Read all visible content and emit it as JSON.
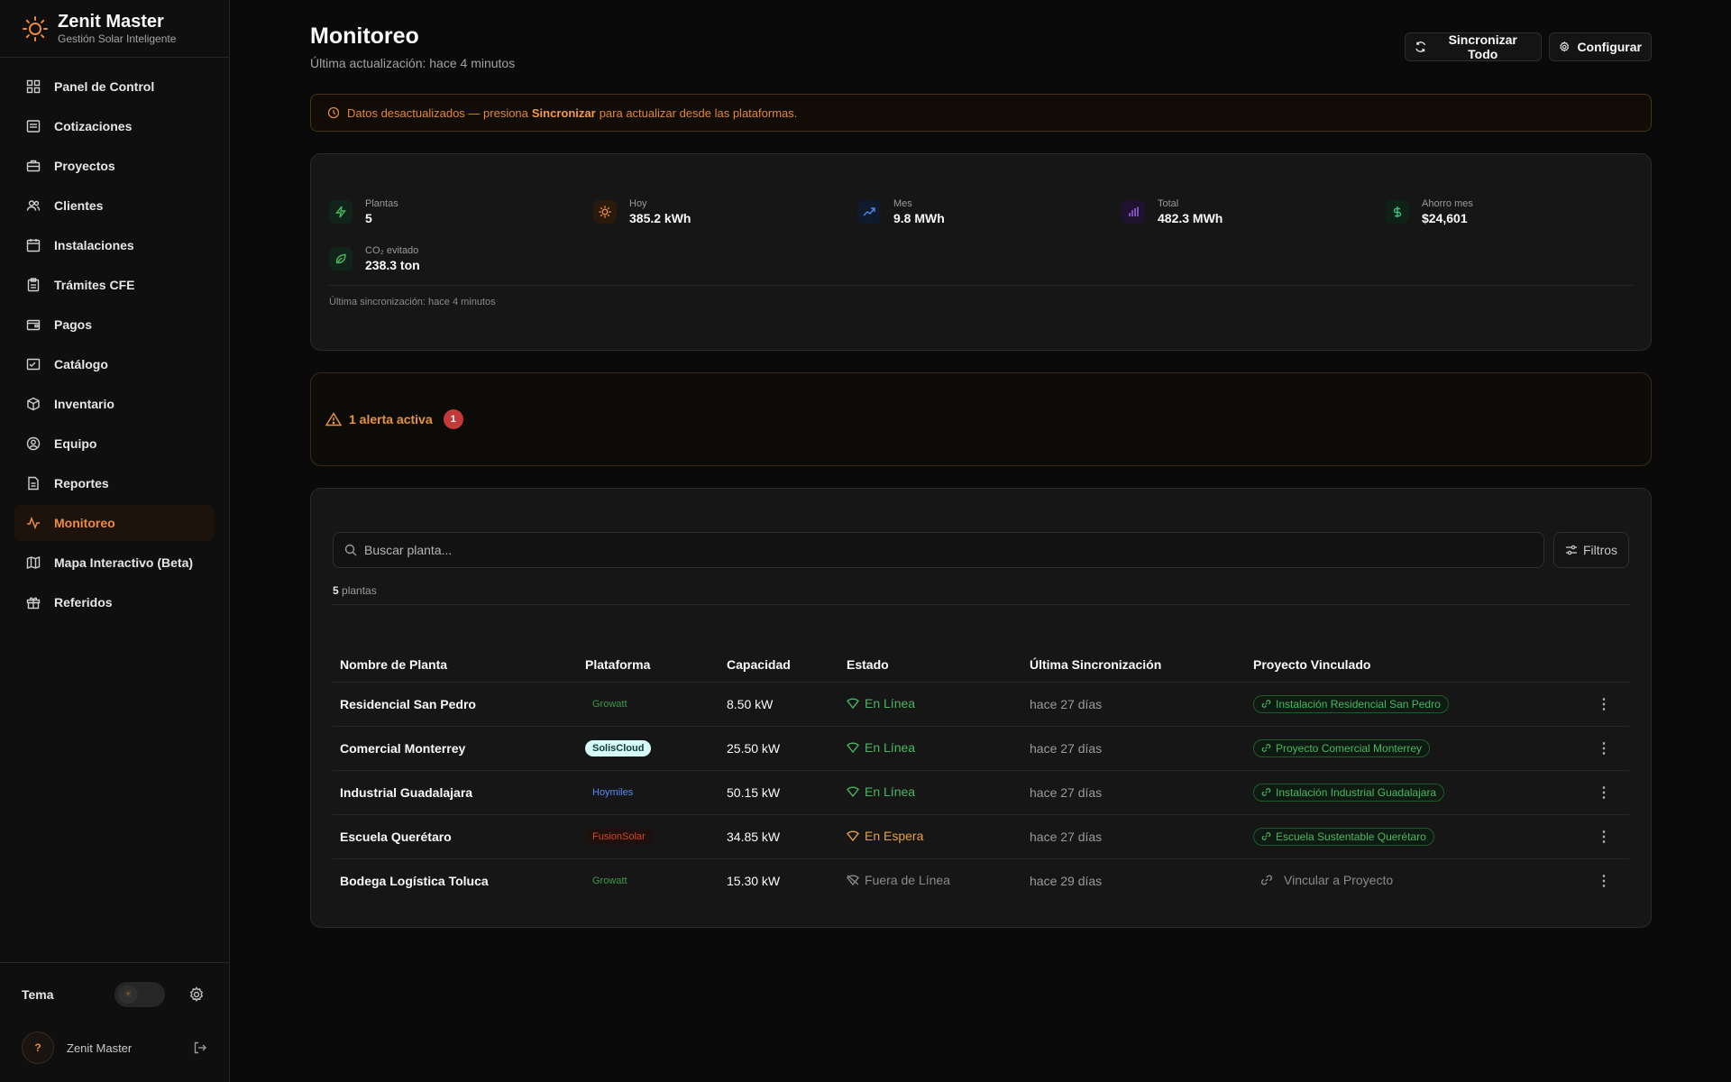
{
  "brand": {
    "title": "Zenit Master",
    "subtitle": "Gestión Solar Inteligente"
  },
  "sidebar": {
    "items": [
      {
        "label": "Panel de Control",
        "icon": "dashboard-icon"
      },
      {
        "label": "Cotizaciones",
        "icon": "quote-icon"
      },
      {
        "label": "Proyectos",
        "icon": "briefcase-icon"
      },
      {
        "label": "Clientes",
        "icon": "users-icon"
      },
      {
        "label": "Instalaciones",
        "icon": "calendar-icon"
      },
      {
        "label": "Trámites CFE",
        "icon": "clipboard-icon"
      },
      {
        "label": "Pagos",
        "icon": "wallet-icon"
      },
      {
        "label": "Catálogo",
        "icon": "catalog-icon"
      },
      {
        "label": "Inventario",
        "icon": "box-icon"
      },
      {
        "label": "Equipo",
        "icon": "user-circle-icon"
      },
      {
        "label": "Reportes",
        "icon": "report-icon"
      },
      {
        "label": "Monitoreo",
        "icon": "activity-icon",
        "active": true
      },
      {
        "label": "Mapa Interactivo (Beta)",
        "icon": "map-icon"
      },
      {
        "label": "Referidos",
        "icon": "gift-icon"
      }
    ],
    "theme_label": "Tema",
    "user_name": "Zenit Master",
    "avatar_text": "?"
  },
  "header": {
    "title": "Monitoreo",
    "subtitle": "Última actualización: hace 4 minutos",
    "sync_all": "Sincronizar Todo",
    "configure": "Configurar"
  },
  "warning": {
    "prefix": "Datos desactualizados — presiona",
    "bold": "Sincronizar",
    "suffix": "para actualizar desde las plataformas."
  },
  "stats": {
    "plants": {
      "label": "Plantas",
      "value": "5"
    },
    "today": {
      "label": "Hoy",
      "value": "385.2 kWh"
    },
    "month": {
      "label": "Mes",
      "value": "9.8 MWh"
    },
    "total": {
      "label": "Total",
      "value": "482.3 MWh"
    },
    "savings": {
      "label": "Ahorro mes",
      "value": "$24,601"
    },
    "co2": {
      "label": "CO₂ evitado",
      "value": "238.3 ton"
    },
    "footer": "Última sincronización: hace 4 minutos"
  },
  "alerts": {
    "text": "1 alerta activa",
    "count": "1"
  },
  "plants_table": {
    "search_placeholder": "Buscar planta...",
    "filters_label": "Filtros",
    "count_number": "5",
    "count_suffix": "plantas",
    "headers": [
      "Nombre de Planta",
      "Plataforma",
      "Capacidad",
      "Estado",
      "Última Sincronización",
      "Proyecto Vinculado"
    ],
    "rows": [
      {
        "name": "Residencial San Pedro",
        "platform": "Growatt",
        "capacity": "8.50 kW",
        "status": "En Línea",
        "last_sync": "hace 27 días",
        "project": "Instalación Residencial San Pedro"
      },
      {
        "name": "Comercial Monterrey",
        "platform": "SolisCloud",
        "capacity": "25.50 kW",
        "status": "En Línea",
        "last_sync": "hace 27 días",
        "project": "Proyecto Comercial Monterrey"
      },
      {
        "name": "Industrial Guadalajara",
        "platform": "Hoymiles",
        "capacity": "50.15 kW",
        "status": "En Línea",
        "last_sync": "hace 27 días",
        "project": "Instalación Industrial Guadalajara"
      },
      {
        "name": "Escuela Querétaro",
        "platform": "FusionSolar",
        "capacity": "34.85 kW",
        "status": "En Espera",
        "last_sync": "hace 27 días",
        "project": "Escuela Sustentable Querétaro"
      },
      {
        "name": "Bodega Logística Toluca",
        "platform": "Growatt",
        "capacity": "15.30 kW",
        "status": "Fuera de Línea",
        "last_sync": "hace 29 días",
        "project": "Vincular a Proyecto"
      }
    ]
  },
  "colors": {
    "accent": "#f08a3c",
    "online": "#48b860",
    "waiting": "#e8a23c",
    "offline": "#8a8a8a",
    "alert_badge": "#c23a3a"
  }
}
